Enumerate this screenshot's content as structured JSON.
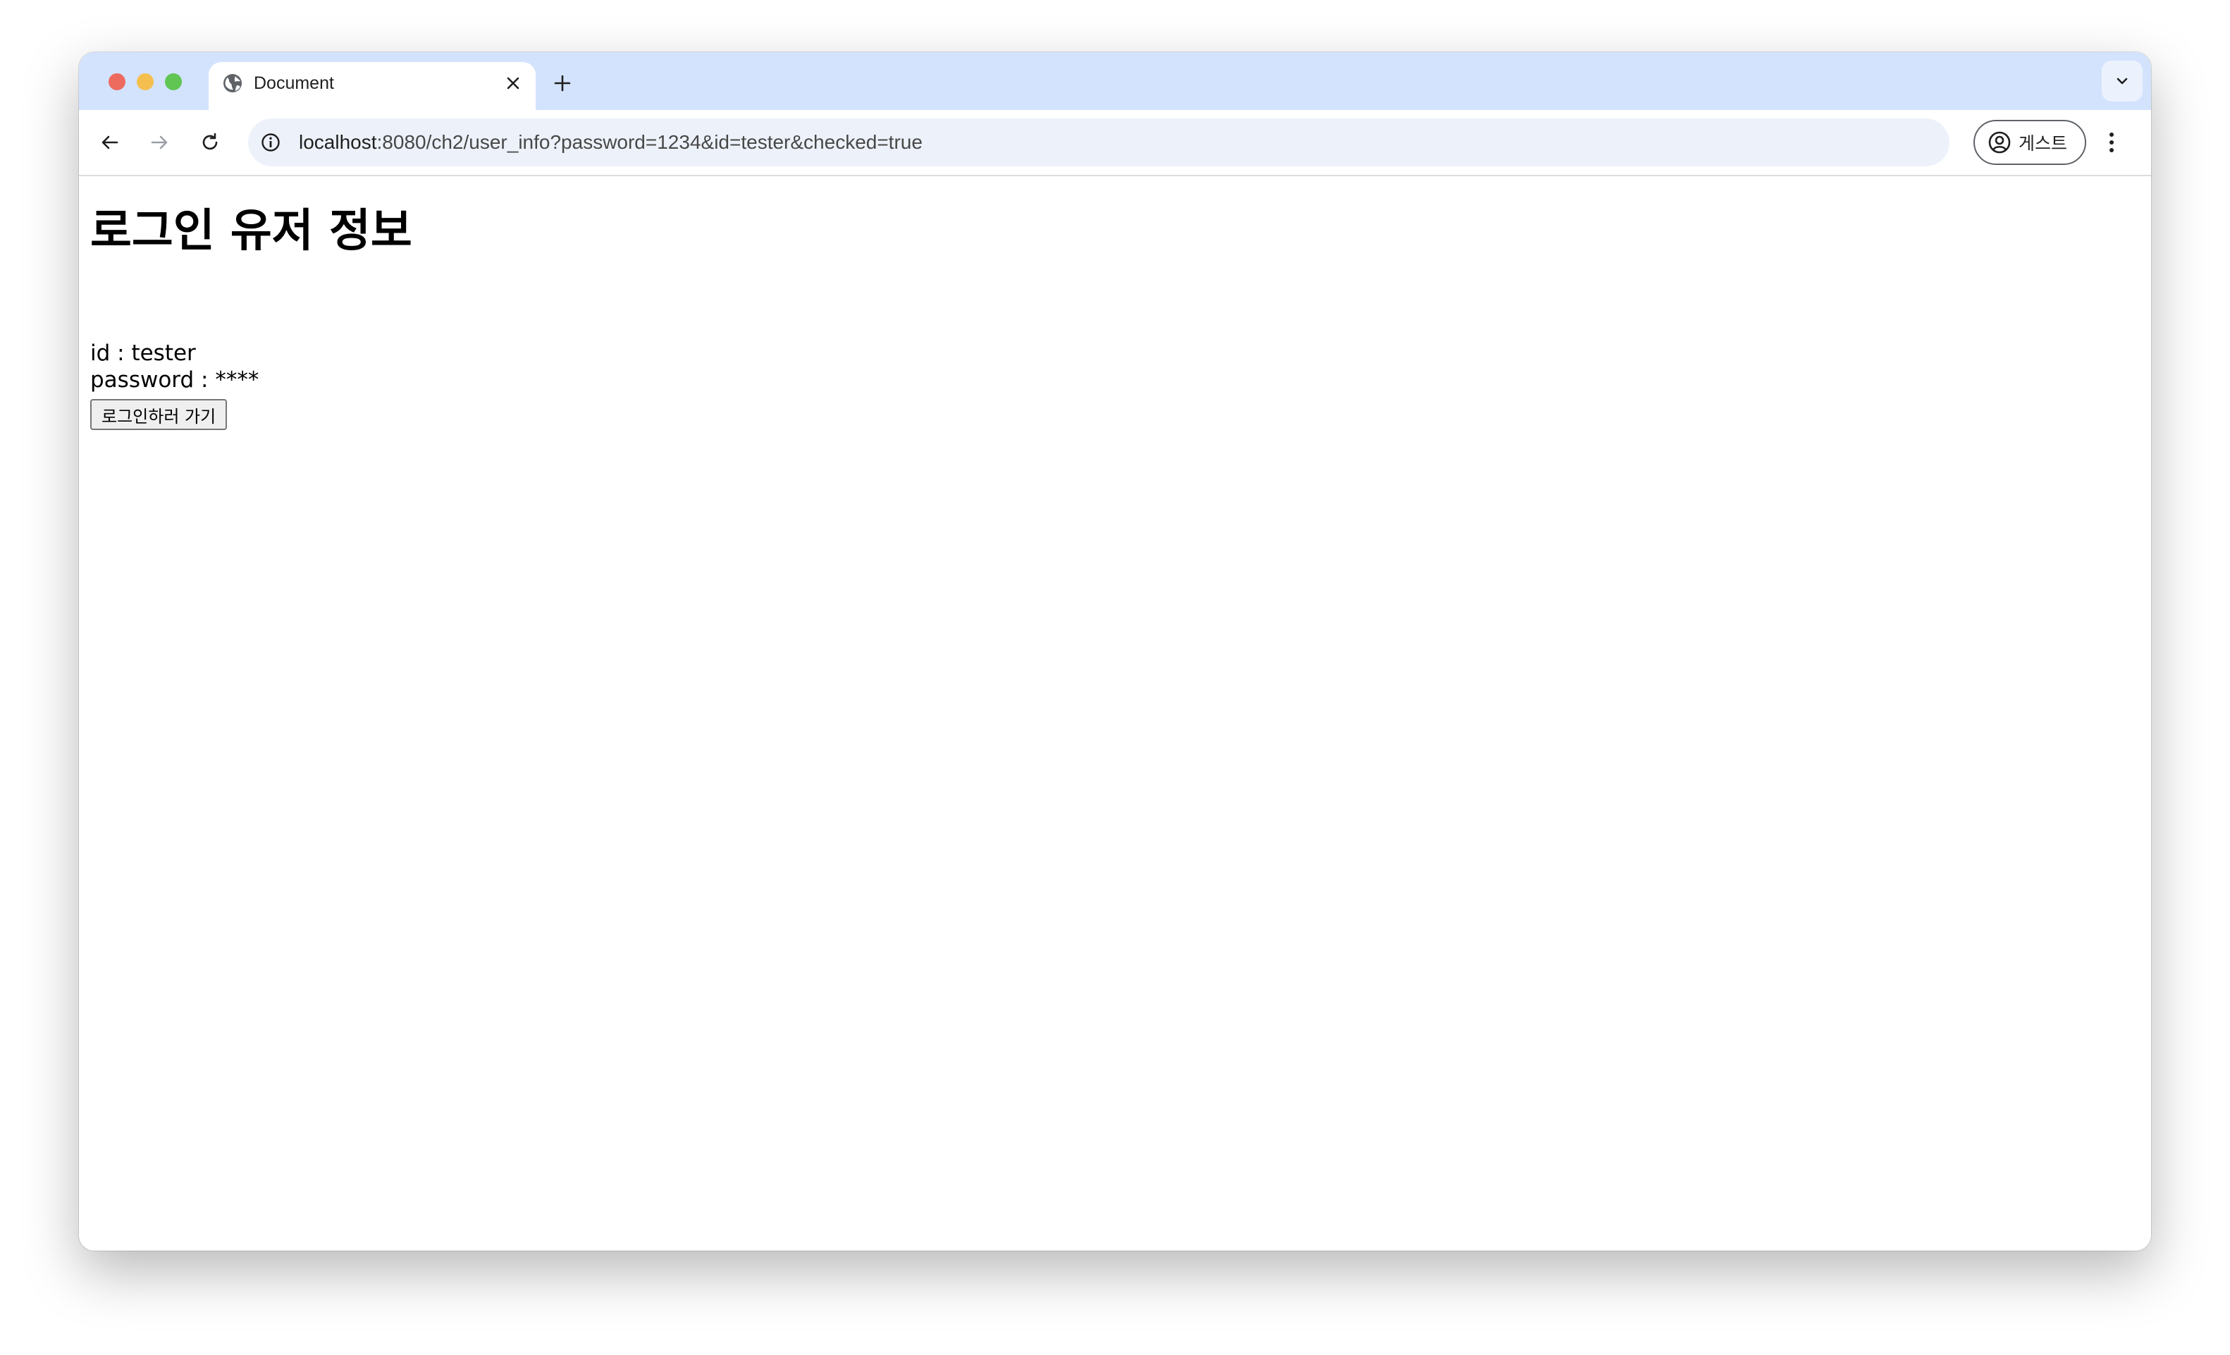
{
  "window": {
    "traffic_lights": {
      "close": "#ed6a5e",
      "minimize": "#f5bf4f",
      "zoom": "#61c554"
    },
    "tab_strip_color": "#d3e3fd"
  },
  "tab": {
    "title": "Document",
    "favicon": "globe-icon"
  },
  "toolbar": {
    "url_host": "localhost",
    "url_rest": ":8080/ch2/user_info?password=1234&id=tester&checked=true",
    "profile_label": "게스트"
  },
  "page": {
    "heading": "로그인 유저 정보",
    "id_line": "id : tester",
    "password_line": "password : ****",
    "login_button_label": "로그인하러 가기"
  }
}
